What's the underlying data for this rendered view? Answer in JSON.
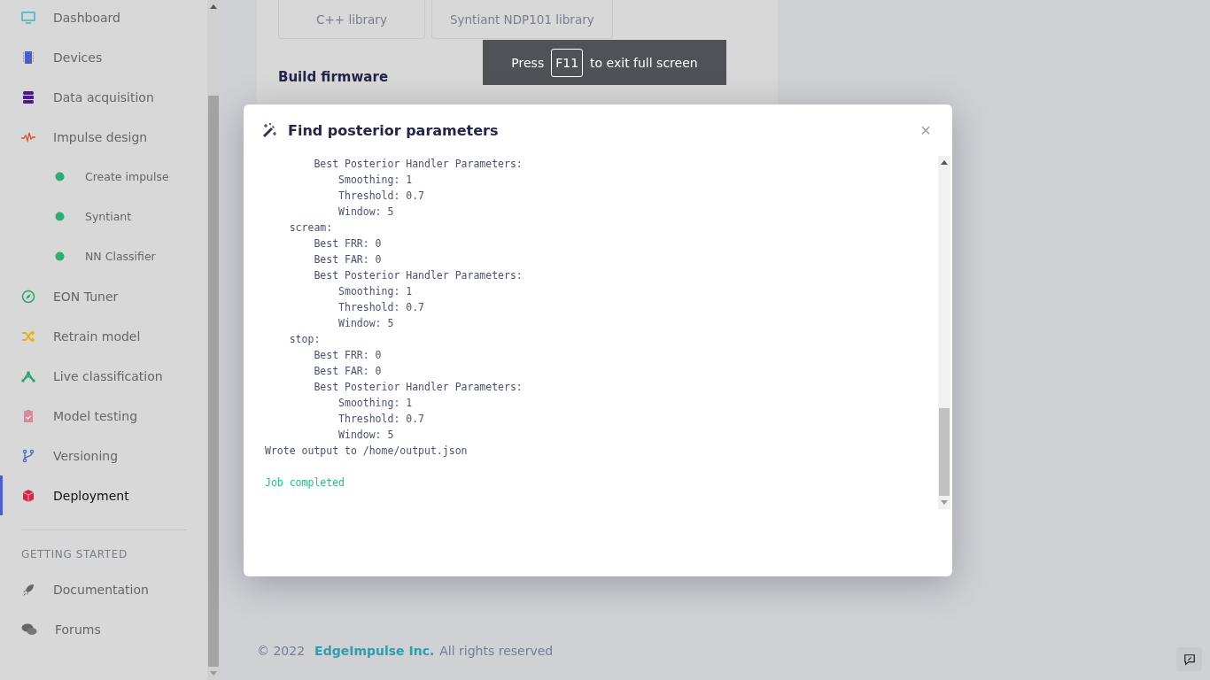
{
  "sidebar": {
    "items": [
      {
        "label": "Dashboard",
        "selected": false
      },
      {
        "label": "Devices",
        "selected": false
      },
      {
        "label": "Data acquisition",
        "selected": false
      },
      {
        "label": "Impulse design",
        "selected": false,
        "children": [
          {
            "label": "Create impulse",
            "selected": false
          },
          {
            "label": "Syntiant",
            "selected": false
          },
          {
            "label": "NN Classifier",
            "selected": false
          }
        ]
      },
      {
        "label": "EON Tuner",
        "selected": false
      },
      {
        "label": "Retrain model",
        "selected": false
      },
      {
        "label": "Live classification",
        "selected": false
      },
      {
        "label": "Model testing",
        "selected": false
      },
      {
        "label": "Versioning",
        "selected": false
      },
      {
        "label": "Deployment",
        "selected": true
      }
    ],
    "section_heading": "GETTING STARTED",
    "links": [
      {
        "label": "Documentation"
      },
      {
        "label": "Forums"
      }
    ]
  },
  "page": {
    "library_buttons": [
      "C++ library",
      "Syntiant NDP101 library"
    ],
    "section_title": "Build firmware"
  },
  "fullscreen_notice": {
    "before": "Press",
    "key": "F11",
    "after": "to exit full screen"
  },
  "modal": {
    "title": "Find posterior parameters",
    "close": "×",
    "log": [
      {
        "text": "        Best Posterior Handler Parameters:",
        "kind": "output"
      },
      {
        "text": "            Smoothing: 1",
        "kind": "output"
      },
      {
        "text": "            Threshold: 0.7",
        "kind": "output"
      },
      {
        "text": "            Window: 5",
        "kind": "output"
      },
      {
        "text": "    scream:",
        "kind": "output"
      },
      {
        "text": "        Best FRR: 0",
        "kind": "output"
      },
      {
        "text": "        Best FAR: 0",
        "kind": "output"
      },
      {
        "text": "        Best Posterior Handler Parameters:",
        "kind": "output"
      },
      {
        "text": "            Smoothing: 1",
        "kind": "output"
      },
      {
        "text": "            Threshold: 0.7",
        "kind": "output"
      },
      {
        "text": "            Window: 5",
        "kind": "output"
      },
      {
        "text": "    stop:",
        "kind": "output"
      },
      {
        "text": "        Best FRR: 0",
        "kind": "output"
      },
      {
        "text": "        Best FAR: 0",
        "kind": "output"
      },
      {
        "text": "        Best Posterior Handler Parameters:",
        "kind": "output"
      },
      {
        "text": "            Smoothing: 1",
        "kind": "output"
      },
      {
        "text": "            Threshold: 0.7",
        "kind": "output"
      },
      {
        "text": "            Window: 5",
        "kind": "output"
      },
      {
        "text": "Wrote output to /home/output.json",
        "kind": "output"
      },
      {
        "text": "Job completed",
        "kind": "success"
      }
    ]
  },
  "footer": {
    "copyright": "© 2022",
    "company": "EdgeImpulse Inc.",
    "rights": "All rights reserved"
  }
}
